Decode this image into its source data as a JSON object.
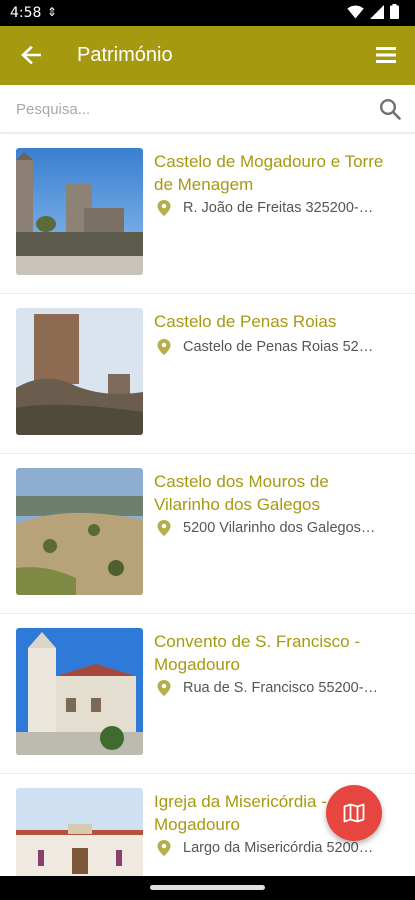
{
  "status_bar": {
    "time": "4:58",
    "sync_glyph": "⇕"
  },
  "app_bar": {
    "title": "Património",
    "back_icon": "arrow-left-icon",
    "menu_icon": "hamburger-menu-icon",
    "color": "#a59a0f"
  },
  "search": {
    "placeholder": "Pesquisa...",
    "value": "",
    "icon": "search-icon"
  },
  "items": [
    {
      "title": "Castelo de Mogadouro e Torre de Menagem",
      "address": "R. João de Freitas 325200-…"
    },
    {
      "title": "Castelo de Penas Roias",
      "address": "Castelo de Penas Roias 52…"
    },
    {
      "title": "Castelo dos Mouros de Vilarinho dos Galegos",
      "address": "5200 Vilarinho dos Galegos…"
    },
    {
      "title": "Convento de S. Francisco - Mogadouro",
      "address": "Rua de S. Francisco 55200-…"
    },
    {
      "title": "Igreja da Misericórdia - Mogadouro",
      "address": "Largo da Misericórdia 5200…"
    }
  ],
  "fab": {
    "icon": "map-icon",
    "color": "#e64540"
  }
}
